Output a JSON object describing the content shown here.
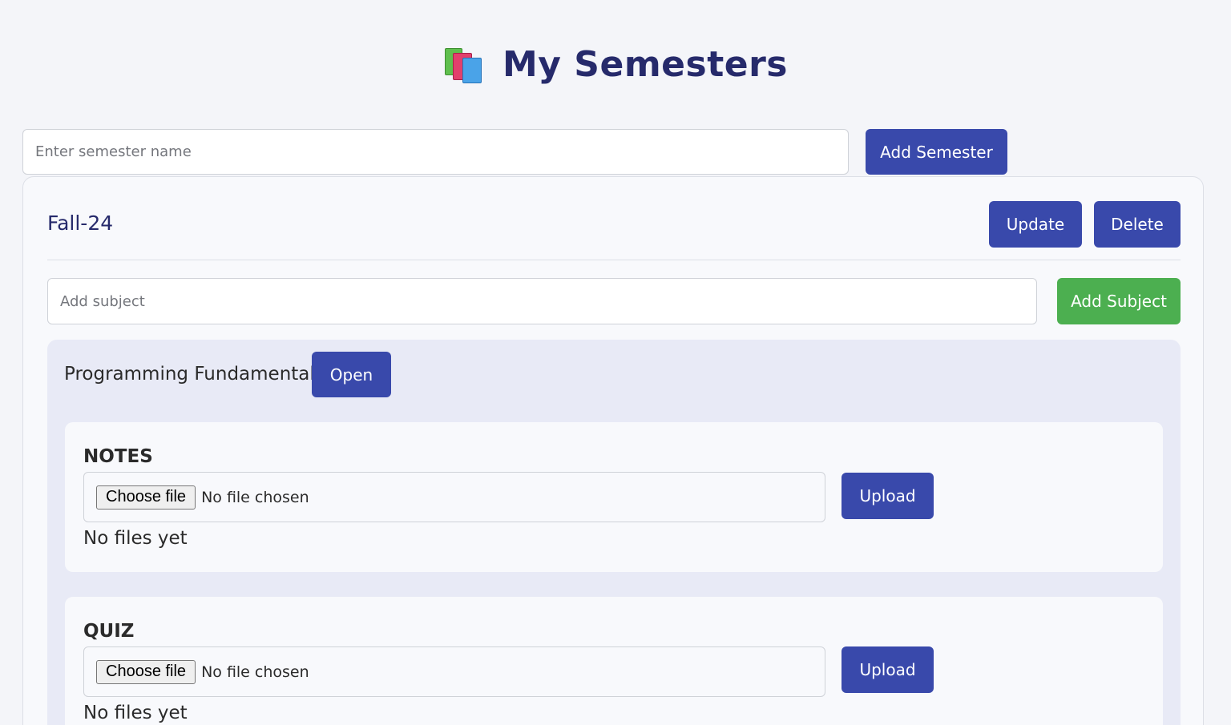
{
  "header": {
    "icon": "books-icon",
    "title": "My Semesters"
  },
  "add_semester": {
    "placeholder": "Enter semester name",
    "value": "",
    "button_label": "Add Semester"
  },
  "semester": {
    "name": "Fall-24",
    "update_label": "Update",
    "delete_label": "Delete",
    "subject_input": {
      "placeholder": "Add subject",
      "value": ""
    },
    "add_subject_label": "Add Subject",
    "subjects": [
      {
        "name": "Programming Fundamental",
        "open_label": "Open",
        "categories": [
          {
            "title": "NOTES",
            "choose_file_label": "Choose file",
            "file_status": "No file chosen",
            "upload_label": "Upload",
            "empty_text": "No files yet"
          },
          {
            "title": "QUIZ",
            "choose_file_label": "Choose file",
            "file_status": "No file chosen",
            "upload_label": "Upload",
            "empty_text": "No files yet"
          }
        ]
      }
    ]
  },
  "colors": {
    "primary": "#3949ab",
    "success": "#4caf50",
    "title": "#262a6b",
    "background": "#f4f5f9",
    "subject_panel": "#e8eaf6"
  }
}
